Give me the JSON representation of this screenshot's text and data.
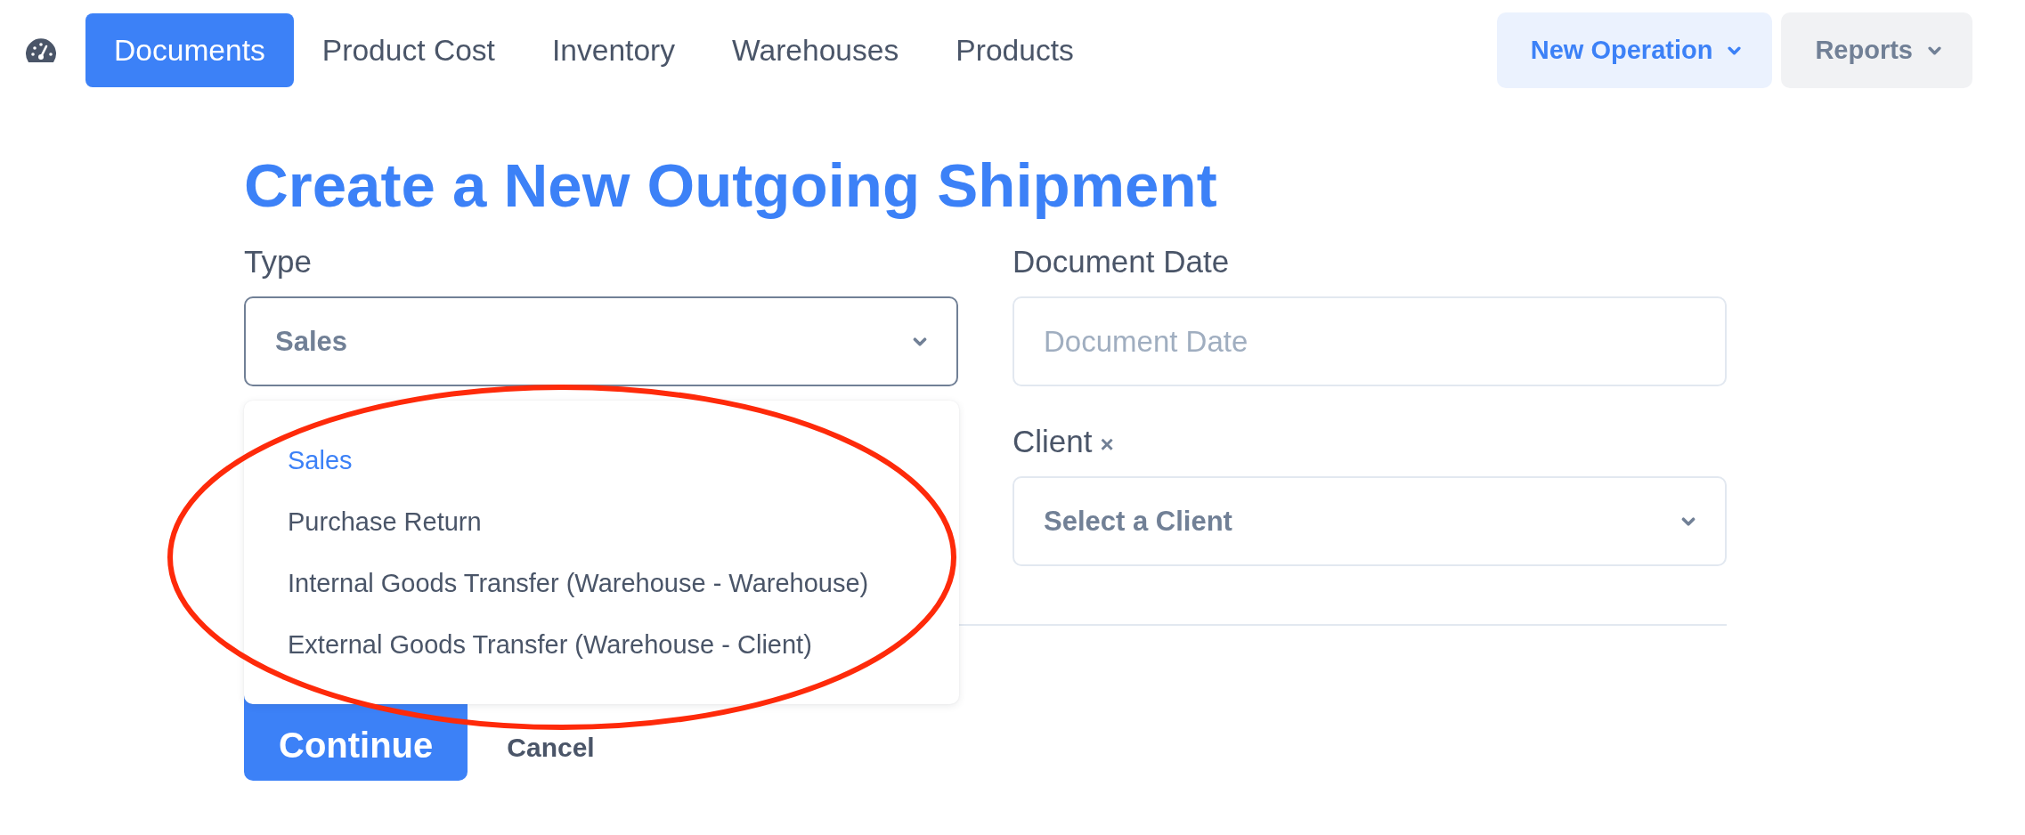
{
  "nav": {
    "items": [
      {
        "label": "Documents",
        "selected": true
      },
      {
        "label": "Product Cost",
        "selected": false
      },
      {
        "label": "Inventory",
        "selected": false
      },
      {
        "label": "Warehouses",
        "selected": false
      },
      {
        "label": "Products",
        "selected": false
      }
    ]
  },
  "actions": [
    {
      "label": "New Operation",
      "kind": "primary"
    },
    {
      "label": "Reports",
      "kind": "secondary"
    }
  ],
  "form": {
    "title": "Create a New Outgoing Shipment",
    "fields": [
      {
        "label": "Type",
        "kind": "select",
        "value": "Sales",
        "open": true,
        "options": [
          {
            "label": "Sales",
            "selected": true
          },
          {
            "label": "Purchase Return",
            "selected": false
          },
          {
            "label": "Internal Goods Transfer (Warehouse - Warehouse)",
            "selected": false
          },
          {
            "label": "External Goods Transfer (Warehouse - Client)",
            "selected": false
          }
        ]
      },
      {
        "label": "Document Date",
        "kind": "date",
        "placeholder": "Document Date"
      },
      {
        "label": "Client",
        "label_mark": "×",
        "kind": "select",
        "placeholder": "Select a Client",
        "open": false
      }
    ],
    "buttons": [
      {
        "label": "Continue",
        "kind": "primary"
      },
      {
        "label": "Cancel",
        "kind": "secondary"
      }
    ]
  },
  "annotation": {
    "kind": "ellipse"
  }
}
